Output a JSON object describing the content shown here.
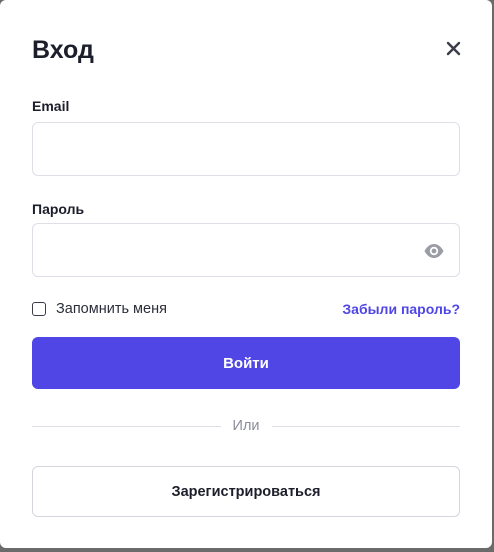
{
  "modal": {
    "title": "Вход"
  },
  "email": {
    "label": "Email",
    "value": "",
    "placeholder": ""
  },
  "password": {
    "label": "Пароль",
    "value": "",
    "placeholder": ""
  },
  "remember": {
    "label": "Запомнить меня",
    "checked": false
  },
  "forgot": {
    "label": "Забыли пароль?"
  },
  "login": {
    "label": "Войти"
  },
  "divider": {
    "label": "Или"
  },
  "register": {
    "label": "Зарегистрироваться"
  },
  "colors": {
    "accent": "#4f46e5",
    "text": "#1c1f2b",
    "border": "#dcdfe6",
    "muted": "#8a8d98"
  },
  "icons": {
    "close": "close-icon",
    "password_toggle": "eye-icon"
  }
}
